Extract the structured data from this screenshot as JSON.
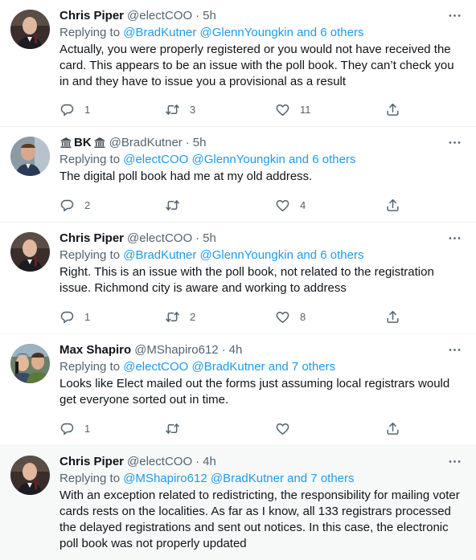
{
  "tweets": [
    {
      "name": "Chris Piper",
      "handle": "@electCOO",
      "time": "5h",
      "replying_to_label": "Replying to",
      "replying_to_links": "@BradKutner @GlennYoungkin and 6 others",
      "text": "Actually, you were properly registered or you would not have received the card. This appears to be an issue with the poll book. They can’t check you in and they have to issue you a provisional as a result",
      "replies": "1",
      "retweets": "3",
      "likes": "11"
    },
    {
      "name": "BK",
      "handle": "@BradKutner",
      "time": "5h",
      "replying_to_label": "Replying to",
      "replying_to_links": "@electCOO @GlennYoungkin and 6 others",
      "text": "The digital poll book had me at my old address.",
      "replies": "2",
      "retweets": "",
      "likes": "4"
    },
    {
      "name": "Chris Piper",
      "handle": "@electCOO",
      "time": "5h",
      "replying_to_label": "Replying to",
      "replying_to_links": "@BradKutner @GlennYoungkin and 6 others",
      "text": "Right. This is an issue with the poll book, not related to the registration issue. Richmond city is aware and working to address",
      "replies": "1",
      "retweets": "2",
      "likes": "8"
    },
    {
      "name": "Max Shapiro",
      "handle": "@MShapiro612",
      "time": "4h",
      "replying_to_label": "Replying to",
      "replying_to_links": "@electCOO @BradKutner and 7 others",
      "text": "Looks like Elect mailed out the forms just assuming local registrars would get everyone sorted out in time.",
      "replies": "1",
      "retweets": "",
      "likes": ""
    },
    {
      "name": "Chris Piper",
      "handle": "@electCOO",
      "time": "4h",
      "replying_to_label": "Replying to",
      "replying_to_links": "@MShapiro612 @BradKutner and 7 others",
      "text": "With an exception related to redistricting, the responsibility for mailing voter cards rests on the localities. As far as I know, all 133 registrars processed the delayed registrations and sent out notices. In this case, the electronic poll book was not properly updated"
    }
  ],
  "separator": "·",
  "colors": {
    "accent": "#1d9bf0",
    "muted": "#536471",
    "text": "#0f1419",
    "highlight_bg": "#f7f9f9"
  },
  "icons": [
    "more-icon",
    "reply-icon",
    "retweet-icon",
    "like-icon",
    "share-icon",
    "bank-emoji-icon"
  ]
}
